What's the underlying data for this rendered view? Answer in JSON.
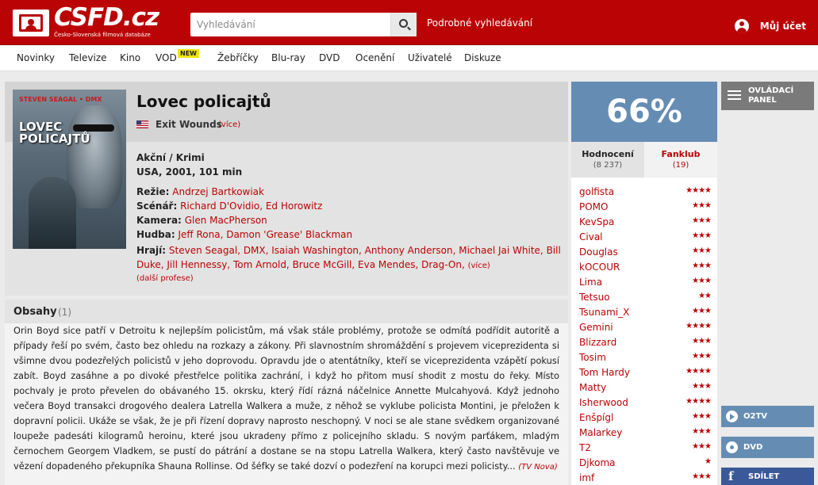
{
  "header": {
    "logo_text": "CSFD.cz",
    "logo_subtitle": "Česko-Slovenská filmová databáze",
    "search_placeholder": "Vyhledávání",
    "advanced_search": "Podrobné vyhledávání",
    "account": "Můj účet"
  },
  "nav": {
    "items": [
      "Novinky",
      "Televize",
      "Kino",
      "VOD",
      "Žebříčky",
      "Blu-ray",
      "DVD",
      "Ocenění",
      "Uživatelé",
      "Diskuze"
    ],
    "new_badge": "NEW"
  },
  "film": {
    "poster_actor": "STEVEN SEAGAL • DMX",
    "poster_title": "LOVEC POLICAJTŮ",
    "title": "Lovec policajtů",
    "alt_title": "Exit Wounds",
    "alt_more": "(více)",
    "genre": "Akční / Krimi",
    "origin": "USA, 2001, 101 min",
    "credits": {
      "director_label": "Režie:",
      "director": "Andrzej Bartkowiak",
      "writer_label": "Scénář:",
      "writer": "Richard D'Ovidio, Ed Horowitz",
      "camera_label": "Kamera:",
      "camera": "Glen MacPherson",
      "music_label": "Hudba:",
      "music": "Jeff Rona, Damon 'Grease' Blackman",
      "cast_label": "Hrají:",
      "cast": "Steven Seagal, DMX, Isaiah Washington, Anthony Anderson, Michael Jai White, Bill Duke, Jill Hennessy, Tom Arnold, Bruce McGill, Eva Mendes, Drag-On,",
      "cast_more": "(více)",
      "other": "(další profese)"
    }
  },
  "plot": {
    "title": "Obsahy",
    "count": "(1)",
    "text": "Orin Boyd sice patří v Detroitu k nejlepším policistům, má však stále problémy, protože se odmítá podřídit autoritě a případy řeší po svém, často bez ohledu na rozkazy a zákony. Při slavnostním shromáždění s projevem viceprezidenta si všimne dvou podezřelých policistů v jeho doprovodu. Opravdu jde o atentátníky, kteří se viceprezidenta vzápětí pokusí zabít. Boyd zasáhne a po divoké přestřelce politika zachrání, i když ho přitom musí shodit z mostu do řeky. Místo pochvaly je proto převelen do obávaného 15. okrsku, který řídí rázná náčelnice Annette Mulcahyová. Když jednoho večera Boyd transakci drogového dealera Latrella Walkera a muže, z něhož se vyklube policista Montini, je přeložen k dopravní policii. Ukáže se však, že je při řízení dopravy naprosto neschopný. V noci se ale stane svědkem organizované loupeže padesáti kilogramů heroinu, které jsou ukradeny přímo z policejního skladu. S novým parťákem, mladým černochem Georgem Vladkem, se pustí do pátrání a dostane se na stopu Latrella Walkera, který často navštěvuje ve vězení dopadeného překupníka Shauna Rollinse. Od šéfky se také dozví o podezření na korupci mezi policisty...",
    "source": "(TV Nova)"
  },
  "rating": {
    "percent": "66%",
    "tab_ratings": "Hodnocení",
    "tab_ratings_count": "(8 237)",
    "tab_fanclub": "Fanklub",
    "tab_fanclub_count": "(19)",
    "users": [
      {
        "name": "golfista",
        "stars": "★★★★"
      },
      {
        "name": "POMO",
        "stars": "★★★"
      },
      {
        "name": "KevSpa",
        "stars": "★★★"
      },
      {
        "name": "Cival",
        "stars": "★★★"
      },
      {
        "name": "Douglas",
        "stars": "★★★"
      },
      {
        "name": "kOCOUR",
        "stars": "★★★"
      },
      {
        "name": "Lima",
        "stars": "★★★"
      },
      {
        "name": "Tetsuo",
        "stars": "★★"
      },
      {
        "name": "Tsunami_X",
        "stars": "★★★"
      },
      {
        "name": "Gemini",
        "stars": "★★★★"
      },
      {
        "name": "Blizzard",
        "stars": "★★★"
      },
      {
        "name": "Tosim",
        "stars": "★★★"
      },
      {
        "name": "Tom Hardy",
        "stars": "★★★★"
      },
      {
        "name": "Matty",
        "stars": "★★★"
      },
      {
        "name": "Isherwood",
        "stars": "★★★★"
      },
      {
        "name": "Enšpígl",
        "stars": "★★★"
      },
      {
        "name": "Malarkey",
        "stars": "★★★"
      },
      {
        "name": "T2",
        "stars": "★★★"
      },
      {
        "name": "Djkoma",
        "stars": "★"
      },
      {
        "name": "imf",
        "stars": "★★★"
      }
    ]
  },
  "sidebar": {
    "panel": "OVLÁDACÍ PANEL",
    "o2tv": "O2TV",
    "dvd": "DVD",
    "share": "SDÍLET",
    "fb_letter": "f"
  },
  "colors": {
    "brand_red": "#ba0305",
    "rating_blue": "#658db4",
    "facebook": "#3b5998"
  }
}
